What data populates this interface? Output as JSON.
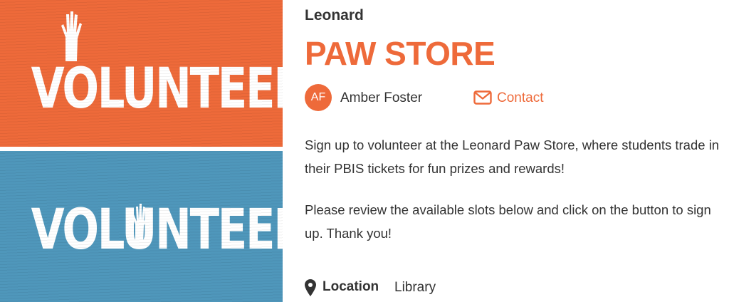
{
  "banner": {
    "top_text": "VOLUNTEER",
    "bottom_text": "VOLUNTEER",
    "top_color": "#ee6a3a",
    "bottom_color": "#4f97bb"
  },
  "header": {
    "org": "Leonard",
    "title": "PAW STORE"
  },
  "author": {
    "initials": "AF",
    "name": "Amber Foster",
    "avatar_color": "#ee6a3a"
  },
  "contact": {
    "label": "Contact",
    "icon": "envelope-icon"
  },
  "description": {
    "paragraph1": "Sign up to volunteer at the Leonard Paw Store, where students trade in their PBIS tickets for fun prizes and rewards!",
    "paragraph2": "Please review the available slots below and click on the button to sign up. Thank you!"
  },
  "location": {
    "label": "Location",
    "value": "Library",
    "icon": "map-pin-icon"
  },
  "colors": {
    "accent": "#ee6a3a",
    "text": "#333333"
  }
}
